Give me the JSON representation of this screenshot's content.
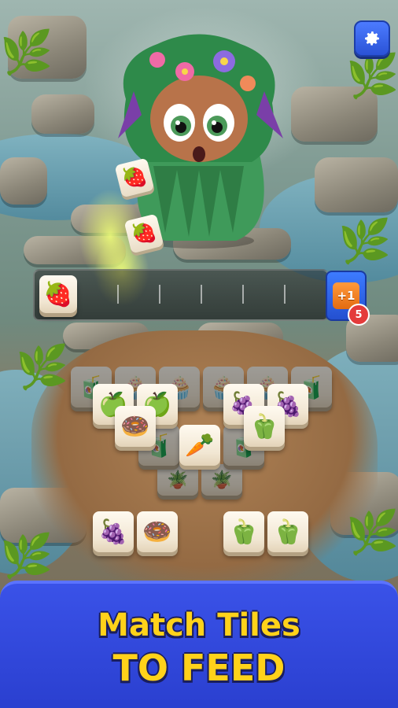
{
  "settings": {
    "icon": "gear-icon"
  },
  "booster": {
    "label": "+1",
    "count": "5"
  },
  "tray": {
    "slots": 7,
    "filled": [
      "strawberry"
    ]
  },
  "flying_tiles": [
    "strawberry",
    "strawberry"
  ],
  "board": {
    "tiles": [
      "juice",
      "cupcake",
      "cupcake",
      "cupcake",
      "cupcake",
      "juice",
      "apple",
      "apple",
      "grapes",
      "grapes",
      "donut",
      "carrot",
      "pepper",
      "juice",
      "juice",
      "grapes",
      "donut",
      "pepper",
      "pepper"
    ]
  },
  "banner": {
    "line1": "Match Tiles",
    "line2": "TO FEED"
  },
  "colors": {
    "banner_bg": "#2a3fcf",
    "banner_text": "#ffd21a",
    "settings_bg": "#2a52d6",
    "booster_badge": "#e43b3b"
  }
}
